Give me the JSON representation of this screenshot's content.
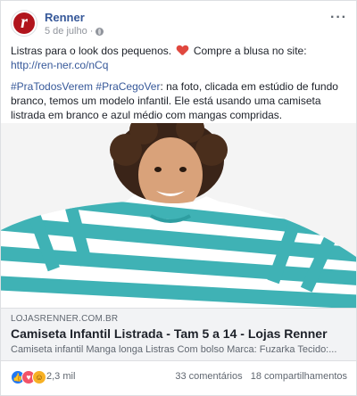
{
  "post": {
    "page_name": "Renner",
    "avatar_letter": "r",
    "date": "5 de julho",
    "more_icon": "···",
    "text": {
      "line1_a": "Listras para o look dos pequenos.",
      "line1_b": "Compre a blusa no site:",
      "link": "http://ren-ner.co/nCq",
      "hashtag1": "#PraTodosVerem",
      "hashtag2": "#PraCegoVer",
      "para2": ": na foto, clicada em estúdio de fundo branco, temos um modelo infantil. Ele está usando uma camiseta listrada em branco e azul médio com mangas compridas."
    }
  },
  "link_preview": {
    "domain": "LOJASRENNER.COM.BR",
    "title": "Camiseta Infantil Listrada - Tam 5 a 14 - Lojas Renner",
    "description": "Camiseta infantil Manga longa Listras Com bolso Marca: Fuzarka Tecido:..."
  },
  "footer": {
    "reaction_count": "2,3 mil",
    "comments": "33 comentários",
    "shares": "18 compartilhamentos"
  },
  "colors": {
    "brand": "#b1141c",
    "link": "#365899",
    "stripe": "#3fb2b5"
  }
}
